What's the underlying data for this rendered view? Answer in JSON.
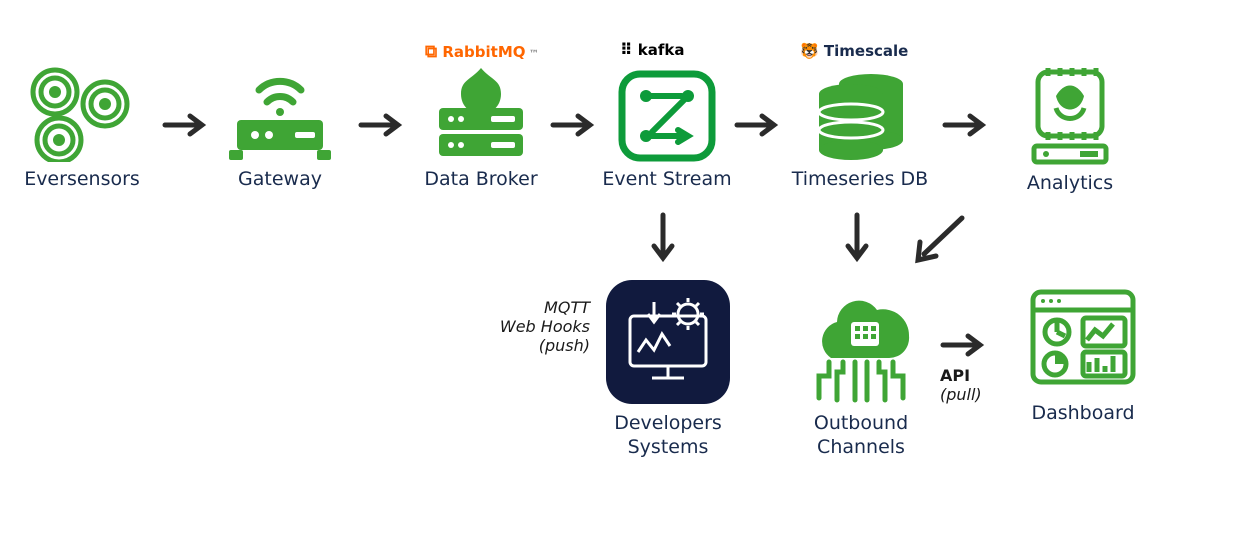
{
  "nodes": {
    "eversensors": {
      "label": "Eversensors"
    },
    "gateway": {
      "label": "Gateway"
    },
    "broker": {
      "label": "Data Broker",
      "topTag": "RabbitMQ"
    },
    "stream": {
      "label": "Event Stream",
      "topTag": "kafka"
    },
    "tsdb": {
      "label": "Timeseries DB",
      "topTag": "Timescale"
    },
    "analytics": {
      "label": "Analytics"
    },
    "devsys": {
      "label": "Developers\nSystems"
    },
    "outbound": {
      "label": "Outbound\nChannels"
    },
    "dashboard": {
      "label": "Dashboard"
    }
  },
  "side": {
    "push": {
      "line1": "MQTT",
      "line2": "Web Hooks",
      "line3": "(push)"
    },
    "pull": {
      "line1": "API",
      "line2": "(pull)"
    }
  },
  "arrows": [
    "eversensors->gateway",
    "gateway->broker",
    "broker->stream",
    "stream->tsdb",
    "tsdb->analytics",
    "stream->devsys",
    "tsdb->outbound",
    "analytics->outbound",
    "outbound->dashboard"
  ],
  "colors": {
    "green": "#3fa535",
    "navy": "#111a3e",
    "text": "#192b4d",
    "rabbit": "#ff6600",
    "arrow": "#2b2b2b"
  }
}
